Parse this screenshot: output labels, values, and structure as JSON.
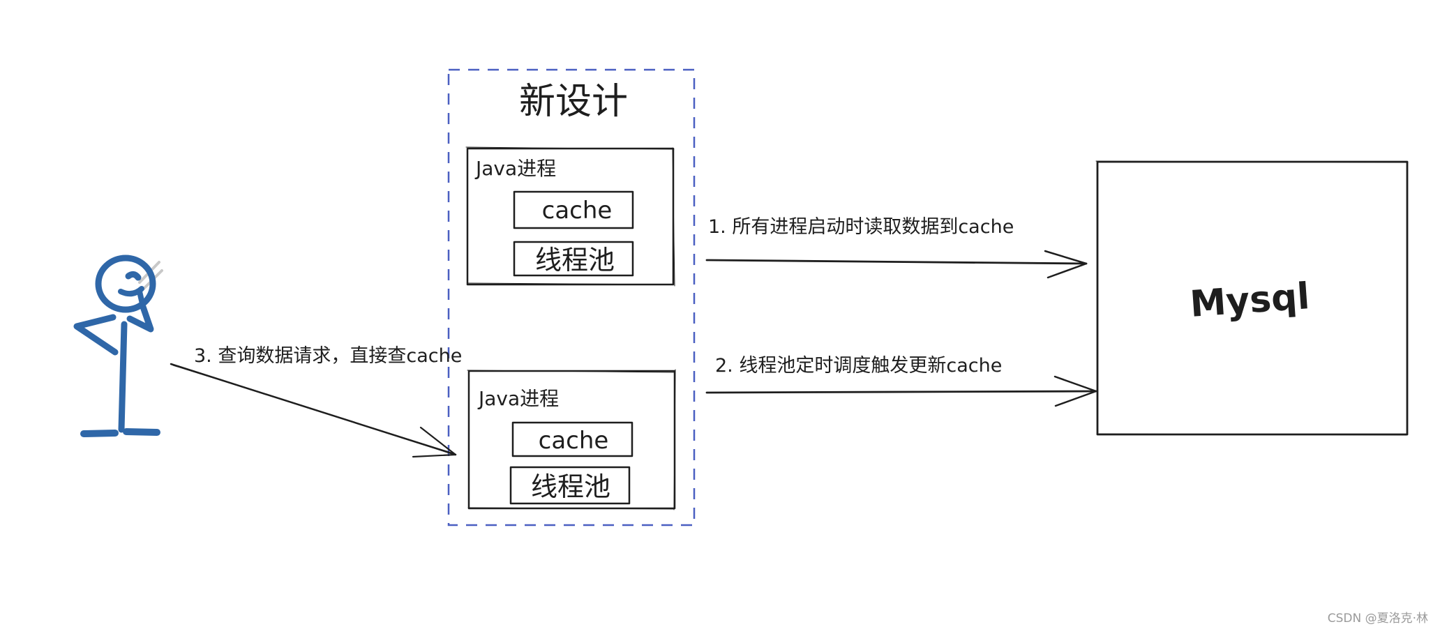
{
  "diagram": {
    "title": "新设计",
    "colors": {
      "ink": "#1e1e1e",
      "group_border": "#4a5fc1",
      "mysql_hatch": "#7b74e0",
      "threadpool_hatch": "#f08c2e",
      "person": "#2f67a8",
      "watermark": "#9a9a9a"
    },
    "processes": [
      {
        "label": "Java进程",
        "cache_label": "cache",
        "threadpool_label": "线程池"
      },
      {
        "label": "Java进程",
        "cache_label": "cache",
        "threadpool_label": "线程池"
      }
    ],
    "database": {
      "label": "Mysql"
    },
    "actor": {
      "icon": "stick-figure-person-icon"
    },
    "arrows": [
      {
        "label": "1. 所有进程启动时读取数据到cache",
        "from": "java-process-1",
        "to": "mysql"
      },
      {
        "label": "2. 线程池定时调度触发更新cache",
        "from": "java-process-2",
        "to": "mysql"
      },
      {
        "label": "3. 查询数据请求，直接查cache",
        "from": "person",
        "to": "java-process-2"
      }
    ]
  },
  "watermark": "CSDN @夏洛克·林"
}
